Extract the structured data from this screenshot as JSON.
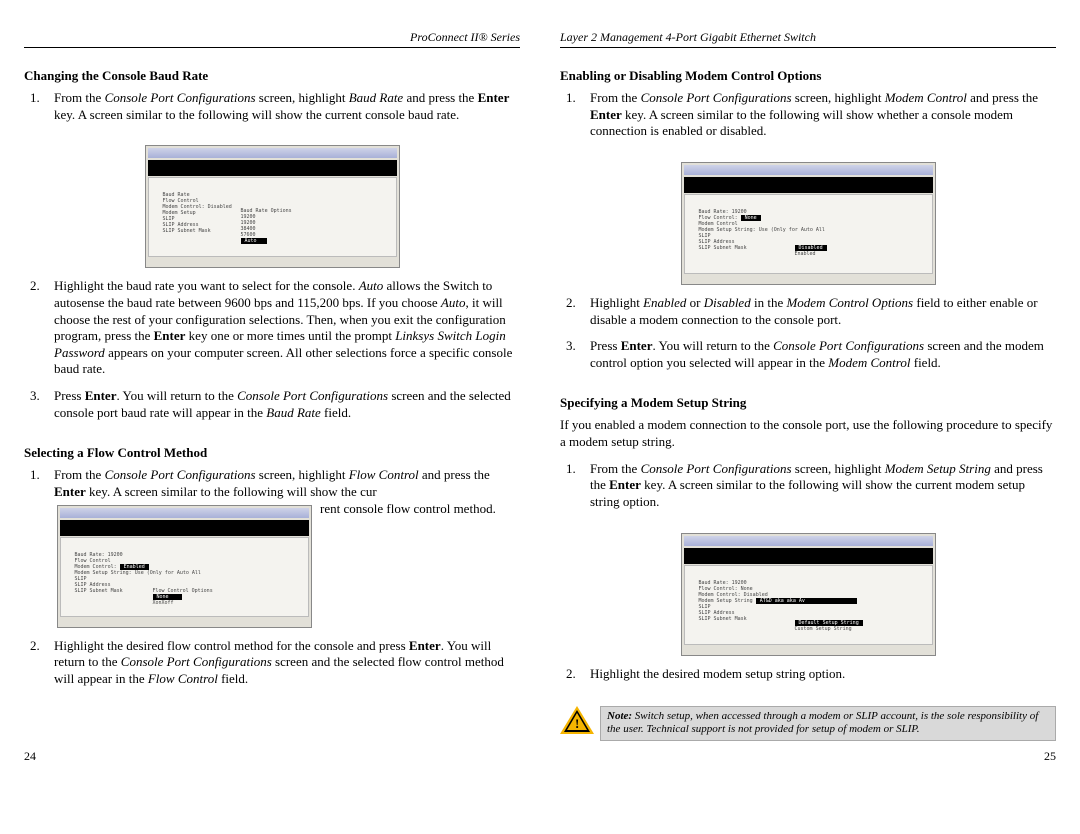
{
  "left": {
    "running_head": "ProConnect II® Series",
    "page_number": "24",
    "section_a_heading": "Changing the Console Baud Rate",
    "section_a_step1_a": "From the ",
    "section_a_step1_b": "Console Port Configurations",
    "section_a_step1_c": " screen, highlight ",
    "section_a_step1_d": "Baud Rate",
    "section_a_step1_e": " and press the ",
    "section_a_step1_f": "Enter",
    "section_a_step1_g": " key. A screen similar to the following will show the current console baud rate.",
    "section_a_step2_a": "Highlight the baud rate you want to select for the console. ",
    "section_a_step2_b": "Auto",
    "section_a_step2_c": " allows the Switch to autosense the baud rate between 9600 bps and 115,200 bps. If you choose ",
    "section_a_step2_d": "Auto",
    "section_a_step2_e": ", it will choose the rest of your configuration selections. Then, when   you exit the configuration program, press the ",
    "section_a_step2_f": "Enter",
    "section_a_step2_g": " key one or more times until the prompt ",
    "section_a_step2_h": "Linksys Switch Login Password",
    "section_a_step2_i": " appears on your computer screen. All other selections force a specific console baud rate.",
    "section_a_step3_a": "Press ",
    "section_a_step3_b": "Enter",
    "section_a_step3_c": ". You will return to the ",
    "section_a_step3_d": "Console Port Configurations",
    "section_a_step3_e": " screen and the selected console port baud rate will appear in the ",
    "section_a_step3_f": "Baud Rate",
    "section_a_step3_g": " field.",
    "section_b_heading": "Selecting a Flow Control Method",
    "section_b_step1_a": "From the ",
    "section_b_step1_b": "Console Port Configurations",
    "section_b_step1_c": " screen, highlight ",
    "section_b_step1_d": "Flow Control",
    "section_b_step1_e": " and press the ",
    "section_b_step1_f": "Enter",
    "section_b_step1_g": " key. A screen similar to the following will show the cur",
    "section_b_step1_tail": "rent console flow control method.",
    "section_b_step2_a": "Highlight the desired flow control method for the console and press ",
    "section_b_step2_b": "Enter",
    "section_b_step2_c": ". You will return to the ",
    "section_b_step2_d": "Console Port Configurations",
    "section_b_step2_e": " screen and the selected flow control method will appear in the ",
    "section_b_step2_f": "Flow Control",
    "section_b_step2_g": " field."
  },
  "right": {
    "running_head": "Layer 2 Management 4-Port Gigabit Ethernet Switch",
    "page_number": "25",
    "section_c_heading": "Enabling or Disabling Modem Control Options",
    "section_c_step1_a": "From the ",
    "section_c_step1_b": "Console Port Configurations",
    "section_c_step1_c": " screen, highlight ",
    "section_c_step1_d": "Modem Control",
    "section_c_step1_e": " and press the ",
    "section_c_step1_f": "Enter",
    "section_c_step1_g": " key. A screen similar to the following will show whether a console modem connection is enabled or disabled.",
    "section_c_step2_a": "Highlight ",
    "section_c_step2_b": "Enabled",
    "section_c_step2_c": " or ",
    "section_c_step2_d": "Disabled",
    "section_c_step2_e": " in the ",
    "section_c_step2_f": "Modem Control Options",
    "section_c_step2_g": " field to either enable or disable a modem connection to the console port.",
    "section_c_step3_a": "Press ",
    "section_c_step3_b": "Enter",
    "section_c_step3_c": ". You will return to the ",
    "section_c_step3_d": "Console Port Configurations",
    "section_c_step3_e": " screen and the modem control option you selected will appear in the ",
    "section_c_step3_f": "Modem Control",
    "section_c_step3_g": " field.",
    "section_d_heading": "Specifying a Modem Setup String",
    "section_d_intro": "If you enabled a modem connection to the console port, use the following procedure to specify a modem setup string.",
    "section_d_step1_a": "From the ",
    "section_d_step1_b": "Console Port Configurations",
    "section_d_step1_c": " screen, highlight ",
    "section_d_step1_d": "Modem Setup String",
    "section_d_step1_e": " and press the ",
    "section_d_step1_f": "Enter",
    "section_d_step1_g": " key. A screen similar to the following will show the current modem setup string option.",
    "section_d_step2": "Highlight the desired modem setup string option.",
    "note_label": "Note:",
    "note_text": " Switch setup, when accessed through a modem or SLIP account, is the sole responsibility of the user. Technical support is not provided for setup of modem or SLIP."
  }
}
